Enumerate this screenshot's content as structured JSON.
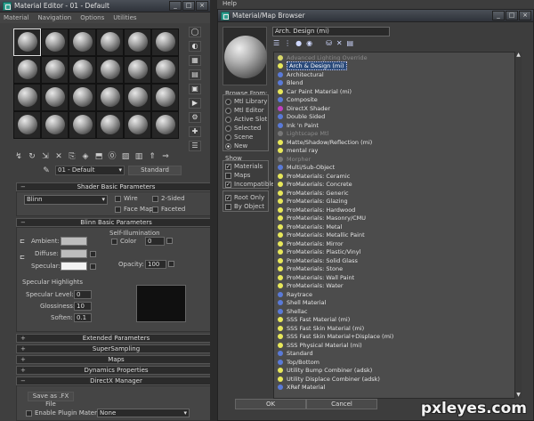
{
  "material_editor": {
    "title": "Material Editor - 01 - Default",
    "menu": [
      "Material",
      "Navigation",
      "Options",
      "Utilities"
    ],
    "material_name": "01 - Default",
    "type_button": "Standard",
    "shader_basic": {
      "header": "Shader Basic Parameters",
      "shader": "Blinn",
      "wire": "Wire",
      "two_sided": "2-Sided",
      "face_map": "Face Map",
      "faceted": "Faceted"
    },
    "blinn_basic": {
      "header": "Blinn Basic Parameters",
      "self_illum": "Self-Illumination",
      "color": "Color",
      "color_value": "0",
      "ambient": "Ambient:",
      "diffuse": "Diffuse:",
      "specular": "Specular:",
      "opacity": "Opacity:",
      "opacity_value": "100"
    },
    "specular_highlights": {
      "title": "Specular Highlights",
      "level": "Specular Level:",
      "level_value": "0",
      "glossiness": "Glossiness:",
      "glossiness_value": "10",
      "soften": "Soften:",
      "soften_value": "0.1"
    },
    "rollouts": [
      "Extended Parameters",
      "SuperSampling",
      "Maps",
      "Dynamics Properties",
      "DirectX Manager"
    ],
    "directx": {
      "save_fx": "Save as .FX File",
      "enable_plugin": "Enable Plugin Material",
      "plugin_value": "None"
    }
  },
  "browser": {
    "title": "Material/Map Browser",
    "search": "Arch. Design (mi)",
    "browse_from": {
      "label": "Browse From:",
      "options": [
        "Mtl Library",
        "Mtl Editor",
        "Active Slot",
        "Selected",
        "Scene",
        "New"
      ],
      "selected": "New"
    },
    "show": {
      "label": "Show",
      "materials": "Materials",
      "maps": "Maps",
      "incompatible": "Incompatible"
    },
    "root_only": "Root Only",
    "by_object": "By Object",
    "items": [
      {
        "name": "Advanced Lighting Override",
        "color": "#d8d86a",
        "grey": true
      },
      {
        "name": "Arch & Design (mi)",
        "color": "#e8e85a",
        "selected": true
      },
      {
        "name": "Architectural",
        "color": "#5a7ad8"
      },
      {
        "name": "Blend",
        "color": "#5a7ad8"
      },
      {
        "name": "Car Paint Material (mi)",
        "color": "#e8e85a"
      },
      {
        "name": "Composite",
        "color": "#5a7ad8"
      },
      {
        "name": "DirectX Shader",
        "color": "#c040c0"
      },
      {
        "name": "Double Sided",
        "color": "#5a7ad8"
      },
      {
        "name": "Ink 'n Paint",
        "color": "#5a7ad8"
      },
      {
        "name": "Lightscape Mtl",
        "color": "#777777",
        "grey": true
      },
      {
        "name": "Matte/Shadow/Reflection (mi)",
        "color": "#e8e85a"
      },
      {
        "name": "mental ray",
        "color": "#e8e85a"
      },
      {
        "name": "Morpher",
        "color": "#777777",
        "grey": true
      },
      {
        "name": "Multi/Sub-Object",
        "color": "#5a7ad8"
      },
      {
        "name": "ProMaterials: Ceramic",
        "color": "#e8e85a"
      },
      {
        "name": "ProMaterials: Concrete",
        "color": "#e8e85a"
      },
      {
        "name": "ProMaterials: Generic",
        "color": "#e8e85a"
      },
      {
        "name": "ProMaterials: Glazing",
        "color": "#e8e85a"
      },
      {
        "name": "ProMaterials: Hardwood",
        "color": "#e8e85a"
      },
      {
        "name": "ProMaterials: Masonry/CMU",
        "color": "#e8e85a"
      },
      {
        "name": "ProMaterials: Metal",
        "color": "#e8e85a"
      },
      {
        "name": "ProMaterials: Metallic Paint",
        "color": "#e8e85a"
      },
      {
        "name": "ProMaterials: Mirror",
        "color": "#e8e85a"
      },
      {
        "name": "ProMaterials: Plastic/Vinyl",
        "color": "#e8e85a"
      },
      {
        "name": "ProMaterials: Solid Glass",
        "color": "#e8e85a"
      },
      {
        "name": "ProMaterials: Stone",
        "color": "#e8e85a"
      },
      {
        "name": "ProMaterials: Wall Paint",
        "color": "#e8e85a"
      },
      {
        "name": "ProMaterials: Water",
        "color": "#e8e85a"
      },
      {
        "name": "Raytrace",
        "color": "#5a7ad8"
      },
      {
        "name": "Shell Material",
        "color": "#5a7ad8"
      },
      {
        "name": "Shellac",
        "color": "#5a7ad8"
      },
      {
        "name": "SSS Fast Material (mi)",
        "color": "#e8e85a"
      },
      {
        "name": "SSS Fast Skin Material (mi)",
        "color": "#e8e85a"
      },
      {
        "name": "SSS Fast Skin Material+Displace (mi)",
        "color": "#e8e85a"
      },
      {
        "name": "SSS Physical Material (mi)",
        "color": "#e8e85a"
      },
      {
        "name": "Standard",
        "color": "#5a7ad8"
      },
      {
        "name": "Top/Bottom",
        "color": "#5a7ad8"
      },
      {
        "name": "Utility Bump Combiner (adsk)",
        "color": "#e8e85a"
      },
      {
        "name": "Utility Displace Combiner (adsk)",
        "color": "#e8e85a"
      },
      {
        "name": "XRef Material",
        "color": "#5a7ad8"
      }
    ],
    "ok": "OK",
    "cancel": "Cancel"
  },
  "help_menu": "Help",
  "watermark": "pxleyes.com"
}
